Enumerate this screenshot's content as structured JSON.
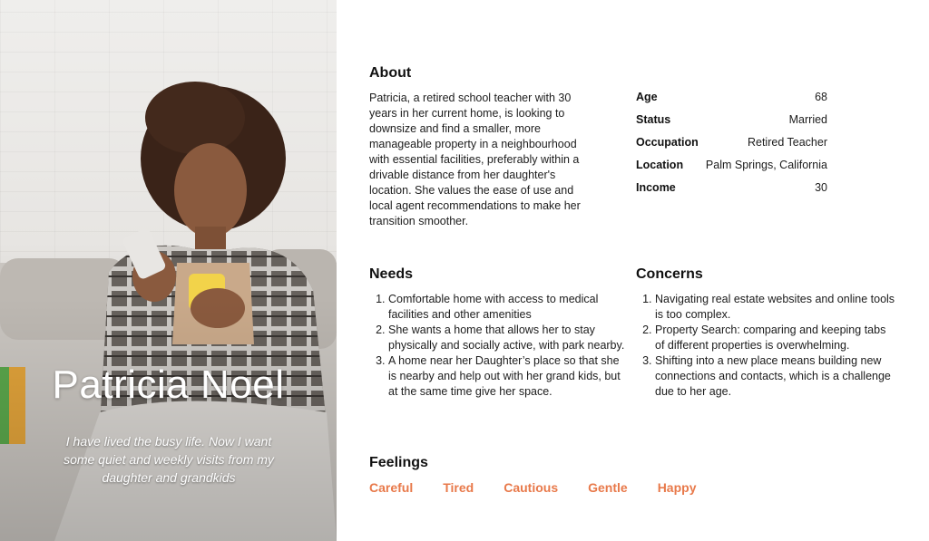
{
  "persona": {
    "name": "Patricia Noel",
    "quote": "I have lived the busy life. Now I want some quiet and weekly visits from my daughter and grandkids"
  },
  "about": {
    "heading": "About",
    "text": "Patricia, a retired school teacher with 30 years in her current home, is looking to downsize and find a smaller, more manageable property in a neighbourhood with essential facilities, preferably within a drivable distance from her daughter's location. She values the ease of use and local agent recommendations to make her transition smoother."
  },
  "facts": [
    {
      "label": "Age",
      "value": "68"
    },
    {
      "label": "Status",
      "value": "Married"
    },
    {
      "label": "Occupation",
      "value": "Retired Teacher"
    },
    {
      "label": "Location",
      "value": "Palm Springs, California"
    },
    {
      "label": "Income",
      "value": "30"
    }
  ],
  "needs": {
    "heading": "Needs",
    "items": [
      "Comfortable home with access to medical facilities and other amenities",
      "She wants a home that allows her to stay physically and socially active, with park nearby.",
      "A home near her Daughter’s place so that she is nearby and help out with her grand kids, but at the same time give her space."
    ]
  },
  "concerns": {
    "heading": "Concerns",
    "items": [
      "Navigating real estate websites and online tools is too complex.",
      "Property Search: comparing and keeping tabs of different properties is overwhelming.",
      "Shifting into a new place means building new connections and contacts, which is a challenge due to her age."
    ]
  },
  "feelings": {
    "heading": "Feelings",
    "items": [
      "Careful",
      "Tired",
      "Cautious",
      "Gentle",
      "Happy"
    ],
    "color": "#e8794a"
  }
}
